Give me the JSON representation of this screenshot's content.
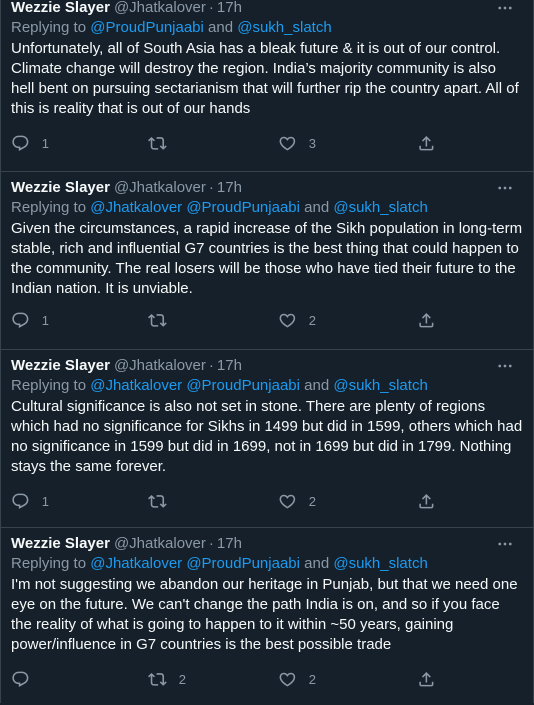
{
  "tweets": [
    {
      "name": "Wezzie Slayer",
      "handle": "@Jhatkalover",
      "dot": "·",
      "time": "17h",
      "replying_prefix": "Replying to ",
      "mentions": [
        "@ProudPunjaabi",
        "@sukh_slatch"
      ],
      "body": "Unfortunately, all of South Asia has a bleak future & it is out of our control. Climate change will destroy the region. India’s majority community is also hell bent on pursuing sectarianism that will further rip the country apart. All of this is reality that is out of our hands",
      "replies": "1",
      "retweets": "",
      "likes": "3"
    },
    {
      "name": "Wezzie Slayer",
      "handle": "@Jhatkalover",
      "dot": "·",
      "time": "17h",
      "replying_prefix": "Replying to ",
      "mentions": [
        "@Jhatkalover",
        "@ProudPunjaabi",
        "@sukh_slatch"
      ],
      "body": "Given the circumstances, a rapid increase of the Sikh population in long-term stable, rich and influential G7 countries is the best thing that could happen to the community. The real losers will be those who have tied their future to the Indian nation. It is unviable.",
      "replies": "1",
      "retweets": "",
      "likes": "2"
    },
    {
      "name": "Wezzie Slayer",
      "handle": "@Jhatkalover",
      "dot": "·",
      "time": "17h",
      "replying_prefix": "Replying to ",
      "mentions": [
        "@Jhatkalover",
        "@ProudPunjaabi",
        "@sukh_slatch"
      ],
      "body": "Cultural significance is also not set in stone. There are plenty of regions which had no significance for Sikhs in 1499 but did in 1599, others which had no significance in 1599 but did in 1699, not in 1699 but did in 1799. Nothing stays the same forever.",
      "replies": "1",
      "retweets": "",
      "likes": "2"
    },
    {
      "name": "Wezzie Slayer",
      "handle": "@Jhatkalover",
      "dot": "·",
      "time": "17h",
      "replying_prefix": "Replying to ",
      "mentions": [
        "@Jhatkalover",
        "@ProudPunjaabi",
        "@sukh_slatch"
      ],
      "body": "I'm not suggesting we abandon our heritage in Punjab, but that we need one eye on the future. We can't change the path India is on, and so if you face the reality of what is going to happen to it within ~50 years, gaining power/influence in G7 countries is the best possible trade",
      "replies": "",
      "retweets": "2",
      "likes": "2"
    }
  ],
  "words": {
    "and": " and ",
    "space": " "
  },
  "icons": {
    "reply": "reply-icon",
    "retweet": "retweet-icon",
    "like": "heart-icon",
    "share": "share-icon",
    "more": "more-icon"
  },
  "colors": {
    "background": "#15202b",
    "text": "#f7f9f9",
    "secondary": "#8b98a5",
    "link": "#1d9bf0",
    "border": "#38444d"
  }
}
